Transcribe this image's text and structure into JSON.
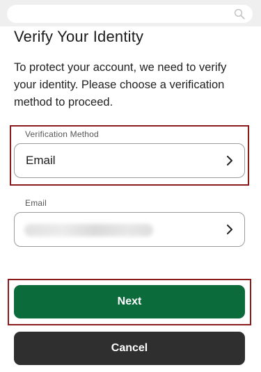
{
  "page": {
    "title": "Verify Your Identity",
    "description": "To protect your account, we need to verify your identity. Please choose a verification method to proceed."
  },
  "search": {
    "icon": "search-icon"
  },
  "verification_method": {
    "label": "Verification Method",
    "value": "Email"
  },
  "email": {
    "label": "Email"
  },
  "buttons": {
    "next_label": "Next",
    "cancel_label": "Cancel"
  },
  "colors": {
    "primary": "#0b6b3a",
    "secondary": "#2f2f2f",
    "highlight_outline": "#8b1a1a"
  }
}
